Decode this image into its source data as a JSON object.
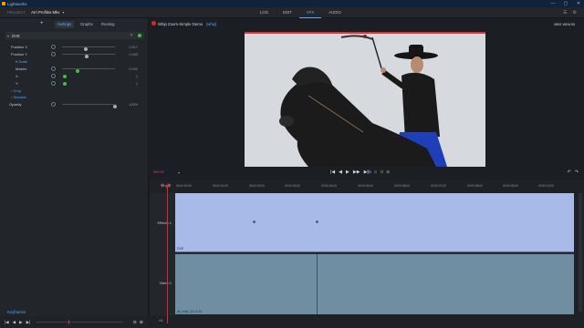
{
  "window": {
    "title": "Lightworks",
    "controls": [
      "—",
      "▢",
      "✕"
    ]
  },
  "menubar": {
    "project_label": "PROJECT",
    "project_name": "Arri Profiles Mkv",
    "caret": "▾",
    "tabs": [
      {
        "label": "LOG",
        "active": false
      },
      {
        "label": "EDIT",
        "active": false
      },
      {
        "label": "VFX",
        "active": true
      },
      {
        "label": "AUDIO",
        "active": false
      }
    ],
    "right_icons": [
      "☰",
      "⚙"
    ]
  },
  "left_panel": {
    "add_button": "+",
    "tabs": [
      {
        "label": "Settings",
        "active": true
      },
      {
        "label": "Graphs",
        "active": false
      },
      {
        "label": "Routing",
        "active": false
      }
    ],
    "effect": {
      "label": "DVE",
      "remove": "✕"
    },
    "params": [
      {
        "name": "Position X",
        "value": "0.517",
        "knob": 0.42,
        "type": "slider"
      },
      {
        "name": "Position Y",
        "value": "0.493",
        "knob": 0.43,
        "type": "slider"
      },
      {
        "name": "Scale",
        "type": "section",
        "expanded": true
      },
      {
        "name": "Master",
        "value": "0.000",
        "knob": 0.3,
        "type": "slider"
      },
      {
        "name": "X",
        "value": "1",
        "type": "dot"
      },
      {
        "name": "Y",
        "value": "1",
        "type": "dot"
      },
      {
        "name": "Crop",
        "type": "section",
        "expanded": false
      },
      {
        "name": "Shadow",
        "type": "section",
        "expanded": false
      },
      {
        "name": "Opacity",
        "value": "100%",
        "knob": 1.0,
        "type": "slider"
      }
    ],
    "keyframes_title": "Keyframes",
    "transport": [
      "|◀",
      "◀",
      "▶",
      "▶|"
    ],
    "zoom": [
      "⊖",
      "⊕"
    ]
  },
  "viewer": {
    "title": "Whip Zoom-Simple Demo",
    "tag": "[whip]",
    "right_label": "BBS WINOB",
    "tc_label": "000:00",
    "tc_caret": "▾",
    "play_buttons": [
      "|◀",
      "◀",
      "▶",
      "▶▶",
      "▶|"
    ],
    "extra_buttons": [
      "⊞",
      "⊙",
      "⊡",
      "⊠"
    ],
    "undo_buttons": [
      "↶",
      "↷"
    ]
  },
  "timeline": {
    "zoom_icons": [
      "⊖",
      "⊕"
    ],
    "ruler_ticks": [
      "00:00:00;00",
      "00:00:01;00",
      "00:00:02;00",
      "00:00:03;00",
      "00:00:04;00",
      "00:00:05;00",
      "00:00:06;00",
      "00:00:07;00",
      "00:00:08;00",
      "00:00:09;00",
      "00:00:10;00"
    ],
    "tracks": [
      {
        "label": "Effects 1",
        "clip": "DVE"
      },
      {
        "label": "Video 1",
        "clip": "jht_whip_00:10:22"
      }
    ],
    "footer_label": "All"
  }
}
